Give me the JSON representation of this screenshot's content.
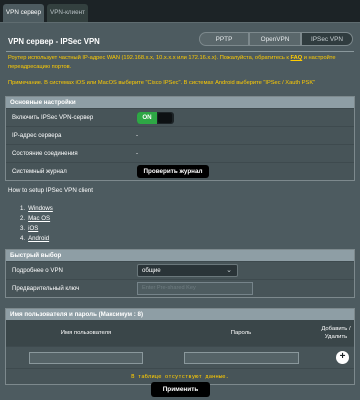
{
  "tabs": [
    {
      "label": "VPN сервер",
      "active": true
    },
    {
      "label": "VPN-клиент",
      "active": false
    }
  ],
  "page_title": "VPN сервер - IPSec VPN",
  "protocols": [
    "PPTP",
    "OpenVPN",
    "IPSec VPN"
  ],
  "notice": {
    "router_prefix": "Роутер использует частный IP-адрес WAN (192.168.x.x, 10.x.x.x или 172.16.x.x). Пожалуйста, обратитесь к ",
    "faq_link": "FAQ",
    "router_suffix": " и настройте переадресацию портов.",
    "note": "Примечание. В системах iOS или MacOS выберите \"Cisco IPSec\". В системах Android выберите \"IPSec / Xauth PSK\""
  },
  "basic": {
    "title": "Основные настройки",
    "enable_label": "Включить IPSec VPN-сервер",
    "toggle_on": "ON",
    "server_ip_label": "IP-адрес сервера",
    "server_ip_value": "-",
    "status_label": "Состояние соединения",
    "status_value": "-",
    "log_label": "Системный журнал",
    "log_button": "Проверить журнал"
  },
  "howto": {
    "title": "How to setup IPSec VPN client",
    "items": [
      {
        "num": "1.",
        "label": "Windows"
      },
      {
        "num": "2.",
        "label": "Mac OS"
      },
      {
        "num": "3.",
        "label": "iOS"
      },
      {
        "num": "4.",
        "label": "Android"
      }
    ]
  },
  "quick": {
    "title": "Быстрый выбор",
    "vpn_details_label": "Подробнее о VPN",
    "vpn_details_value": "общие",
    "psk_label": "Предварительный ключ",
    "psk_placeholder": "Enter Pre-shared Key"
  },
  "users": {
    "title": "Имя пользователя и пароль (Максимум : 8)",
    "col_username": "Имя пользователя",
    "col_password": "Пароль",
    "col_add_line1": "Добавить /",
    "col_add_line2": "Удалить",
    "empty_text": "В таблице отсутствуют данные."
  },
  "apply_button": "Применить",
  "colors": {
    "background": "#1c2326",
    "panel": "#4d5b60",
    "section_header": "#8e9ea5",
    "toggle_on": "#2ea745",
    "notice_text": "#ffcc00"
  },
  "icons": {
    "add": "plus-circle-icon",
    "select": "chevron-down-icon"
  }
}
